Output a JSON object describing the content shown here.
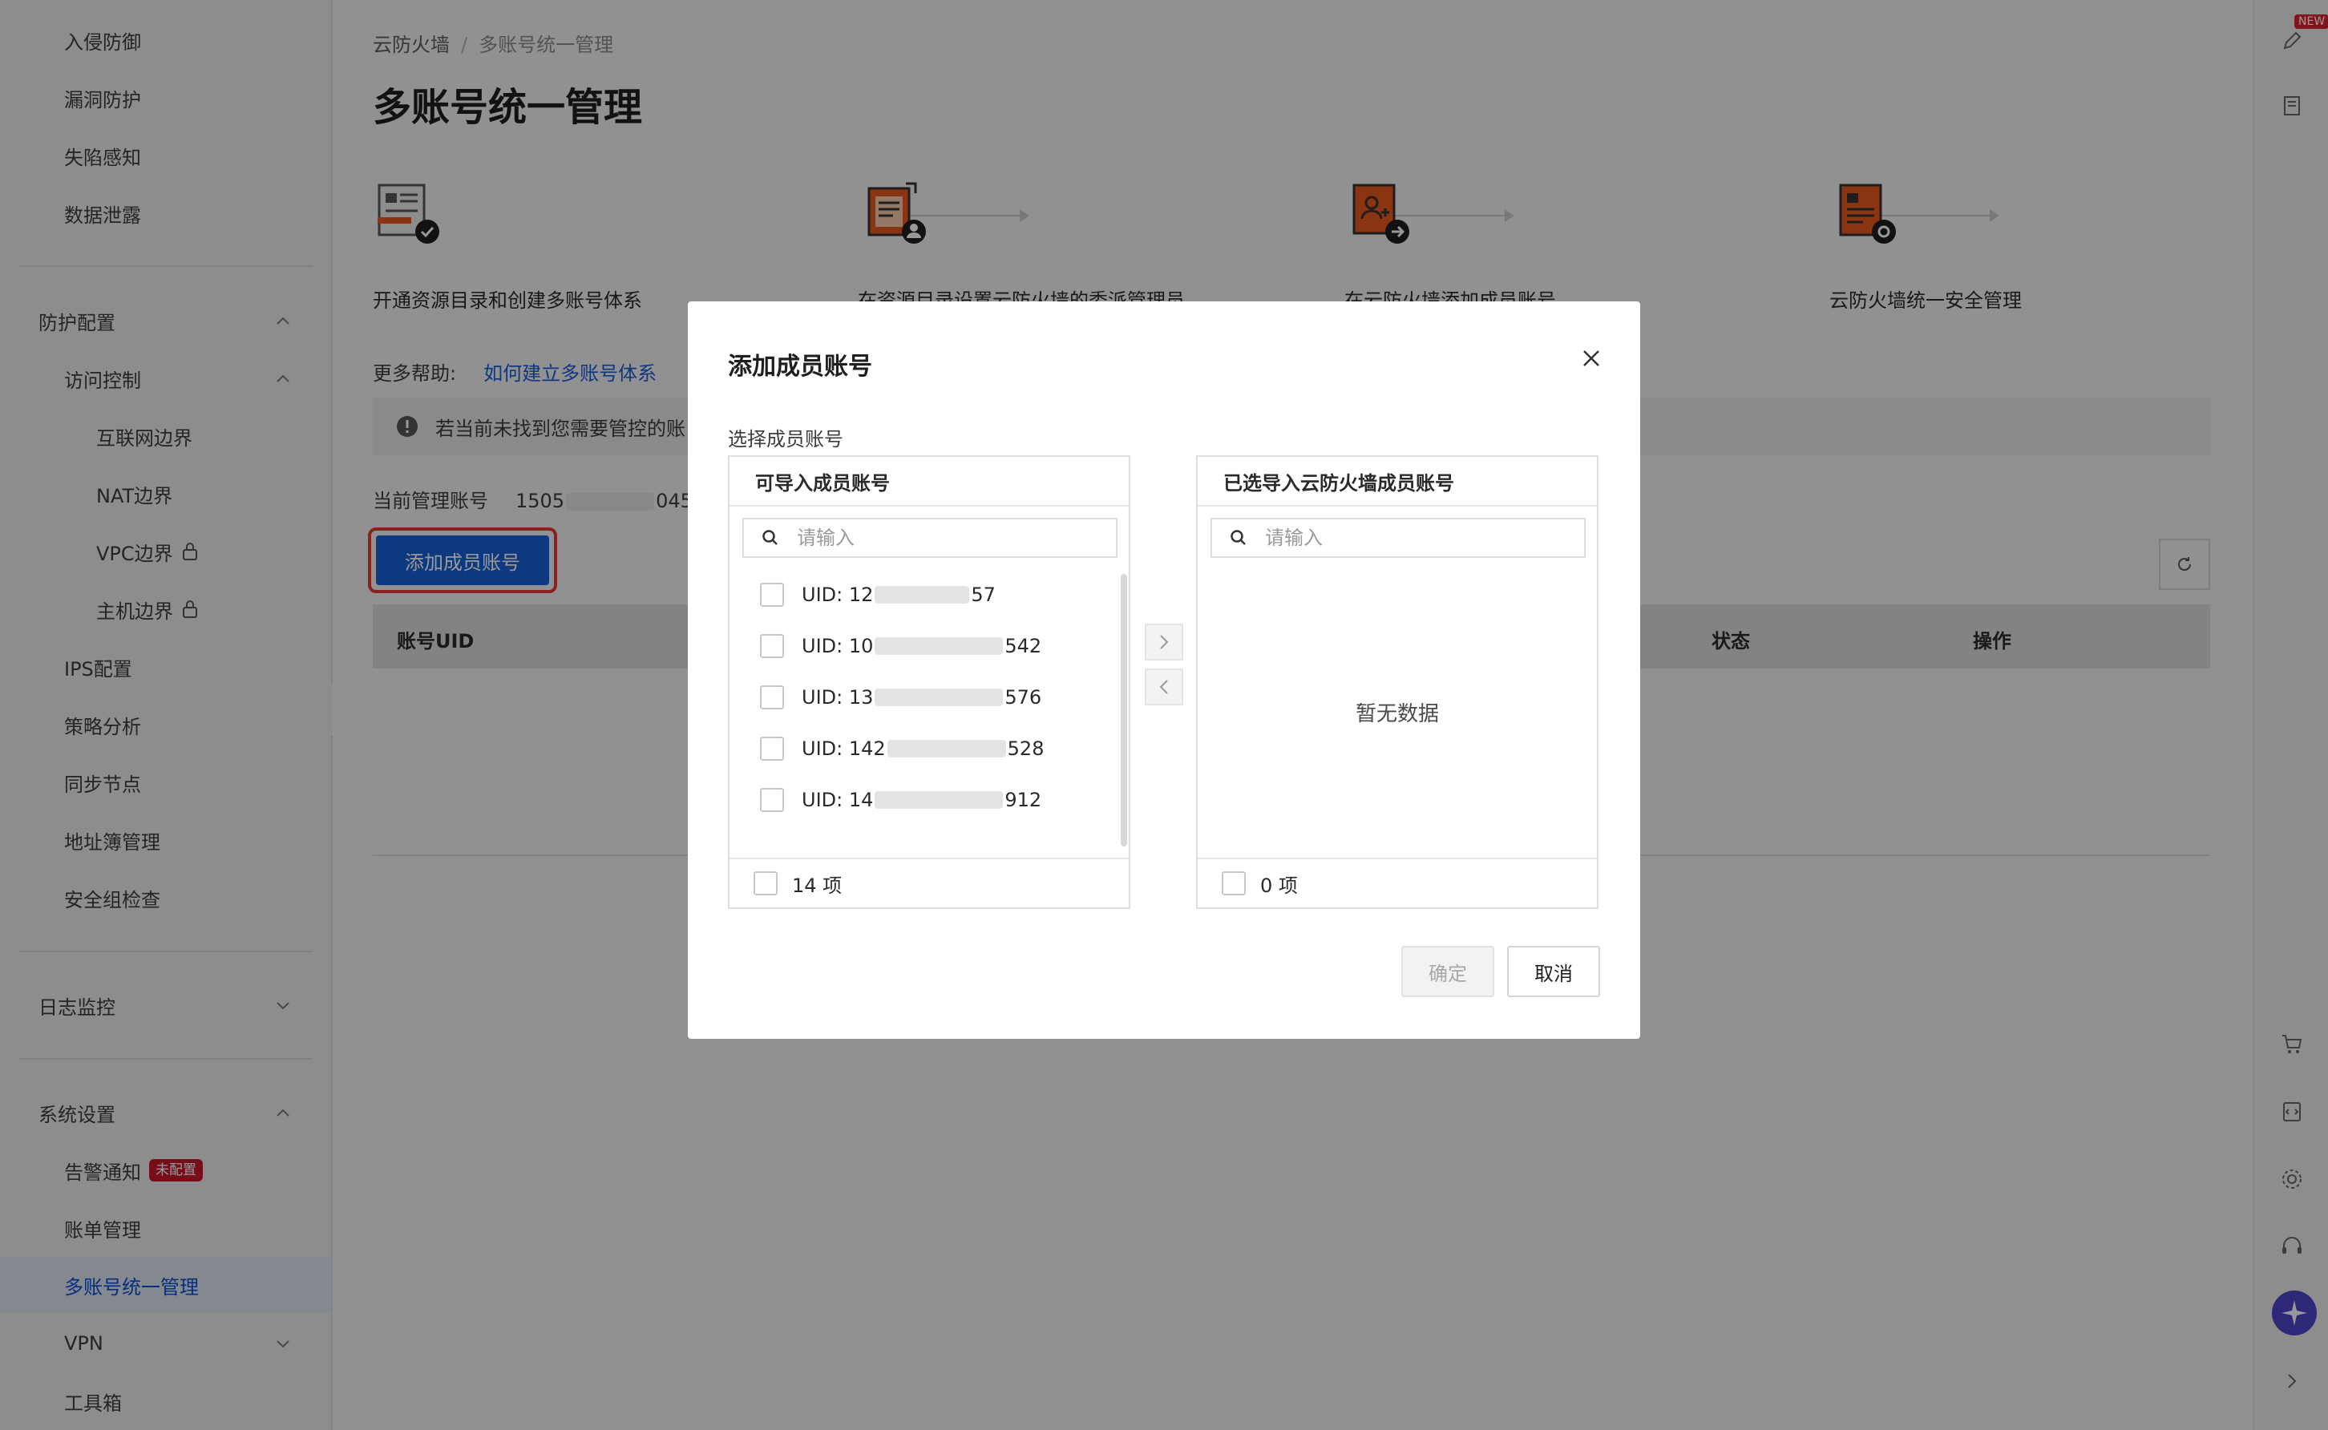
{
  "sidebar": {
    "items_top": [
      "入侵防御",
      "漏洞防护",
      "失陷感知",
      "数据泄露"
    ],
    "protection_group": "防护配置",
    "access_control": "访问控制",
    "access_items": [
      "互联网边界",
      "NAT边界",
      "VPC边界",
      "主机边界"
    ],
    "protection_items": [
      "IPS配置",
      "策略分析",
      "同步节点",
      "地址簿管理",
      "安全组检查"
    ],
    "log_group": "日志监控",
    "system_group": "系统设置",
    "alert": "告警通知",
    "alert_badge": "未配置",
    "billing": "账单管理",
    "multi_account": "多账号统一管理",
    "vpn": "VPN",
    "toolbox": "工具箱"
  },
  "main": {
    "breadcrumb": [
      "云防火墙",
      "多账号统一管理"
    ],
    "title": "多账号统一管理",
    "steps": [
      "开通资源目录和创建多账号体系",
      "在资源目录设置云防火墙的委派管理员",
      "在云防火墙添加成员账号",
      "云防火墙统一安全管理"
    ],
    "help_label": "更多帮助:",
    "help_link": "如何建立多账号体系",
    "notice": "若当前未找到您需要管控的账",
    "current_label": "当前管理账号",
    "current_value": "1505",
    "current_value_end": "045",
    "add_button": "添加成员账号",
    "table_cols": [
      "账号UID",
      "状态",
      "操作"
    ]
  },
  "rail": {
    "new_badge": "NEW"
  },
  "modal": {
    "title": "添加成员账号",
    "field_label": "选择成员账号",
    "left": {
      "title": "可导入成员账号",
      "search_placeholder": "请输入",
      "items": [
        {
          "prefix": "UID: 12",
          "suffix": "57"
        },
        {
          "prefix": "UID: 10",
          "suffix": "542"
        },
        {
          "prefix": "UID: 13",
          "suffix": "576"
        },
        {
          "prefix": "UID: 142",
          "suffix": "528"
        },
        {
          "prefix": "UID: 14",
          "suffix": "912"
        }
      ],
      "count": "14 项"
    },
    "right": {
      "title": "已选导入云防火墙成员账号",
      "search_placeholder": "请输入",
      "empty": "暂无数据",
      "count": "0 项"
    },
    "ok": "确定",
    "cancel": "取消"
  }
}
